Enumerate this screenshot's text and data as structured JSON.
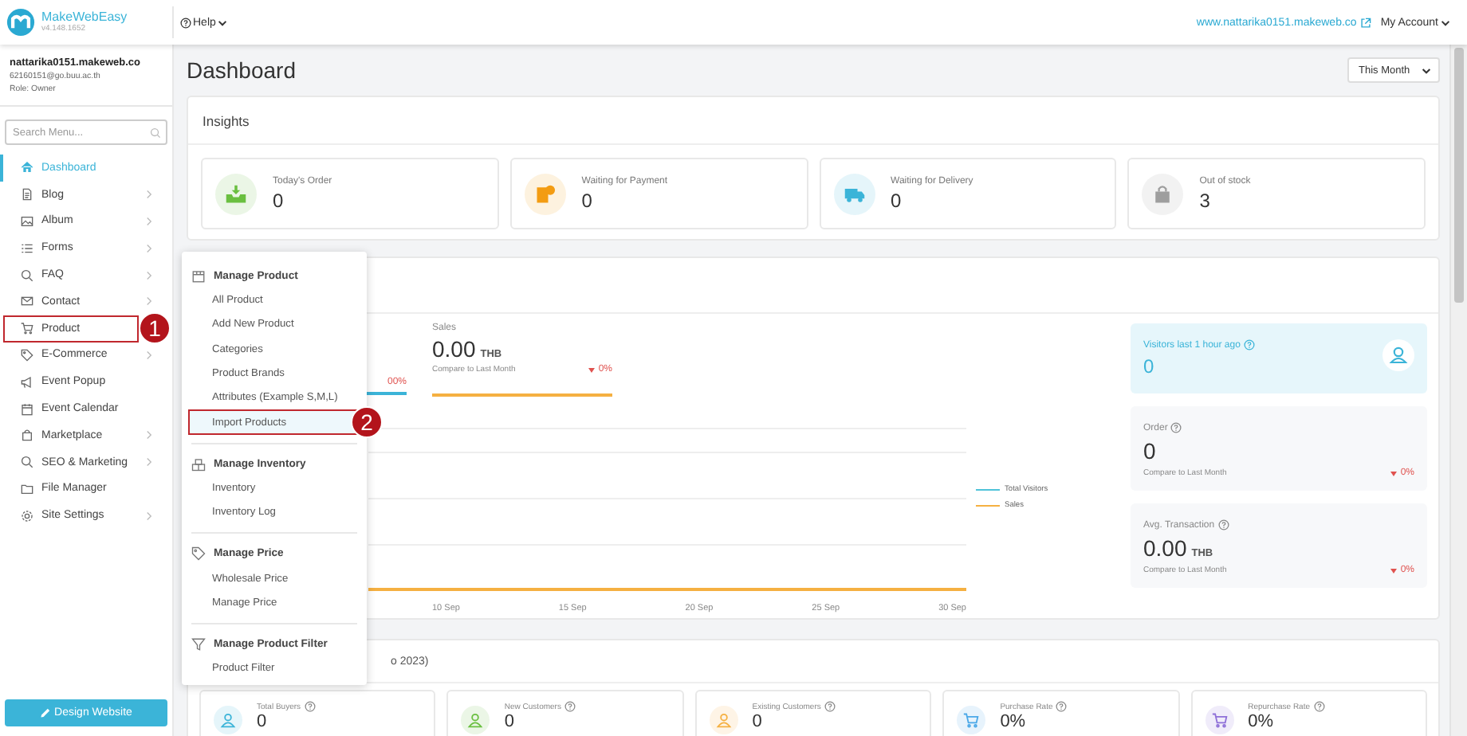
{
  "header": {
    "app_name": "MakeWebEasy",
    "version": "v4.148.1652",
    "help": "Help",
    "site_link": "www.nattarika0151.makeweb.co",
    "account": "My Account"
  },
  "sidebar": {
    "user": {
      "site": "nattarika0151.makeweb.co",
      "email": "62160151@go.buu.ac.th",
      "role": "Role: Owner"
    },
    "search": {
      "placeholder": "Search Menu..."
    },
    "items": [
      {
        "label": "Dashboard",
        "selected": true,
        "has_submenu": false
      },
      {
        "label": "Blog",
        "selected": false,
        "has_submenu": true
      },
      {
        "label": "Album",
        "selected": false,
        "has_submenu": true
      },
      {
        "label": "Forms",
        "selected": false,
        "has_submenu": true
      },
      {
        "label": "FAQ",
        "selected": false,
        "has_submenu": true
      },
      {
        "label": "Contact",
        "selected": false,
        "has_submenu": true
      },
      {
        "label": "Product",
        "selected": false,
        "has_submenu": false,
        "callout": "1"
      },
      {
        "label": "E-Commerce",
        "selected": false,
        "has_submenu": true
      },
      {
        "label": "Event Popup",
        "selected": false,
        "has_submenu": false
      },
      {
        "label": "Event Calendar",
        "selected": false,
        "has_submenu": false
      },
      {
        "label": "Marketplace",
        "selected": false,
        "has_submenu": true
      },
      {
        "label": "SEO & Marketing",
        "selected": false,
        "has_submenu": true
      },
      {
        "label": "File Manager",
        "selected": false,
        "has_submenu": false
      },
      {
        "label": "Site Settings",
        "selected": false,
        "has_submenu": true
      }
    ],
    "button": "Design Website"
  },
  "page": {
    "title": "Dashboard",
    "period": "This Month"
  },
  "insights": {
    "title": "Insights",
    "stats": [
      {
        "label": "Today's Order",
        "value": "0",
        "color": "#6abf40"
      },
      {
        "label": "Waiting for Payment",
        "value": "0",
        "color": "#f39c12"
      },
      {
        "label": "Waiting for Delivery",
        "value": "0",
        "color": "#3bb4d8"
      },
      {
        "label": "Out of stock",
        "value": "3",
        "color": "#9e9e9e"
      }
    ]
  },
  "analytics": {
    "partial_change": "00%",
    "sales": {
      "label": "Sales",
      "value": "0.00",
      "unit": "THB",
      "compare": "Compare to Last Month",
      "change": "0%"
    },
    "chart": {
      "x_labels": [
        "10 Sep",
        "15 Sep",
        "20 Sep",
        "25 Sep",
        "30 Sep"
      ],
      "legend": [
        {
          "name": "Total Visitors",
          "color": "#4fc3d9"
        },
        {
          "name": "Sales",
          "color": "#f5b041"
        }
      ]
    },
    "side_cards": [
      {
        "kind": "visitors",
        "label": "Visitors last 1 hour ago",
        "value": "0"
      },
      {
        "kind": "stat",
        "label": "Order",
        "value": "0",
        "compare": "Compare to Last Month",
        "change": "0%"
      },
      {
        "kind": "stat",
        "label": "Avg. Transaction",
        "value": "0.00",
        "unit": "THB",
        "compare": "Compare to Last Month",
        "change": "0%"
      }
    ]
  },
  "customers": {
    "title_fragment": "o 2023)",
    "cards": [
      {
        "label": "Total Buyers",
        "value": "0",
        "color": "#3bb4d8"
      },
      {
        "label": "New Customers",
        "value": "0",
        "color": "#6abf40"
      },
      {
        "label": "Existing Customers",
        "value": "0",
        "color": "#f5b041"
      },
      {
        "label": "Purchase Rate",
        "value": "0%",
        "color": "#4aa8e8"
      },
      {
        "label": "Repurchase Rate",
        "value": "0%",
        "color": "#8e6fd8"
      }
    ]
  },
  "product_menu": {
    "groups": [
      {
        "title": "Manage Product",
        "items": [
          {
            "label": "All Product",
            "selected": false
          },
          {
            "label": "Add New Product",
            "selected": false
          },
          {
            "label": "Categories",
            "selected": false
          },
          {
            "label": "Product Brands",
            "selected": false
          },
          {
            "label": "Attributes (Example S,M,L)",
            "selected": false
          },
          {
            "label": "Import Products",
            "selected": true,
            "callout": "2"
          }
        ]
      },
      {
        "title": "Manage Inventory",
        "items": [
          {
            "label": "Inventory",
            "selected": false
          },
          {
            "label": "Inventory Log",
            "selected": false
          }
        ]
      },
      {
        "title": "Manage Price",
        "items": [
          {
            "label": "Wholesale Price",
            "selected": false
          },
          {
            "label": "Manage Price",
            "selected": false
          }
        ]
      },
      {
        "title": "Manage Product Filter",
        "items": [
          {
            "label": "Product Filter",
            "selected": false
          }
        ]
      }
    ]
  }
}
